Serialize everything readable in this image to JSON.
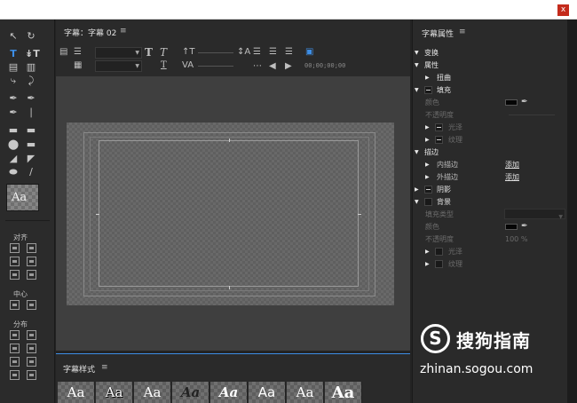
{
  "titlebar": {
    "close_glyph": "x"
  },
  "tools": {
    "sample_text": "Aa",
    "align_label": "对齐",
    "center_label": "中心",
    "distribute_label": "分布",
    "icons": [
      "selection-tool",
      "rotation-tool",
      "type-tool",
      "vertical-type-tool",
      "area-type-tool",
      "vertical-area-type-tool",
      "path-type-tool",
      "vertical-path-type-tool",
      "pen-tool",
      "delete-anchor-tool",
      "add-anchor-tool",
      "convert-anchor-tool",
      "rectangle-tool",
      "rounded-rectangle-tool",
      "clipped-rectangle-tool",
      "rounded-corner-rectangle-tool",
      "wedge-tool",
      "arc-tool",
      "ellipse-tool",
      "line-tool"
    ]
  },
  "editor": {
    "tab_title": "字幕：字幕 02",
    "menu_glyph": "≡",
    "timecode": "00;00;00;00"
  },
  "properties": {
    "title": "字幕属性",
    "menu_glyph": "≡",
    "rows": {
      "transform": "变换",
      "attributes": "属性",
      "distort": "扭曲",
      "fill": "填充",
      "color": "颜色",
      "opacity": "不透明度",
      "sheen": "光泽",
      "texture": "纹理",
      "stroke": "描边",
      "inner_stroke": "内描边",
      "outer_stroke": "外描边",
      "add": "添加",
      "shadow": "阴影",
      "background": "背景",
      "fill_type": "填充类型",
      "bg_color": "颜色",
      "bg_opacity": "不透明度",
      "bg_opacity_value": "100 %",
      "bg_sheen": "光泽",
      "bg_texture": "纹理"
    }
  },
  "styles": {
    "title": "字幕样式",
    "menu_glyph": "≡",
    "swatches": [
      "Aa",
      "Aa",
      "Aa",
      "Aa",
      "Aa",
      "Aa",
      "Aa",
      "Aa"
    ]
  },
  "watermark": {
    "logo_glyph": "S",
    "brand": "搜狗指南",
    "url": "zhinan.sogou.com"
  }
}
